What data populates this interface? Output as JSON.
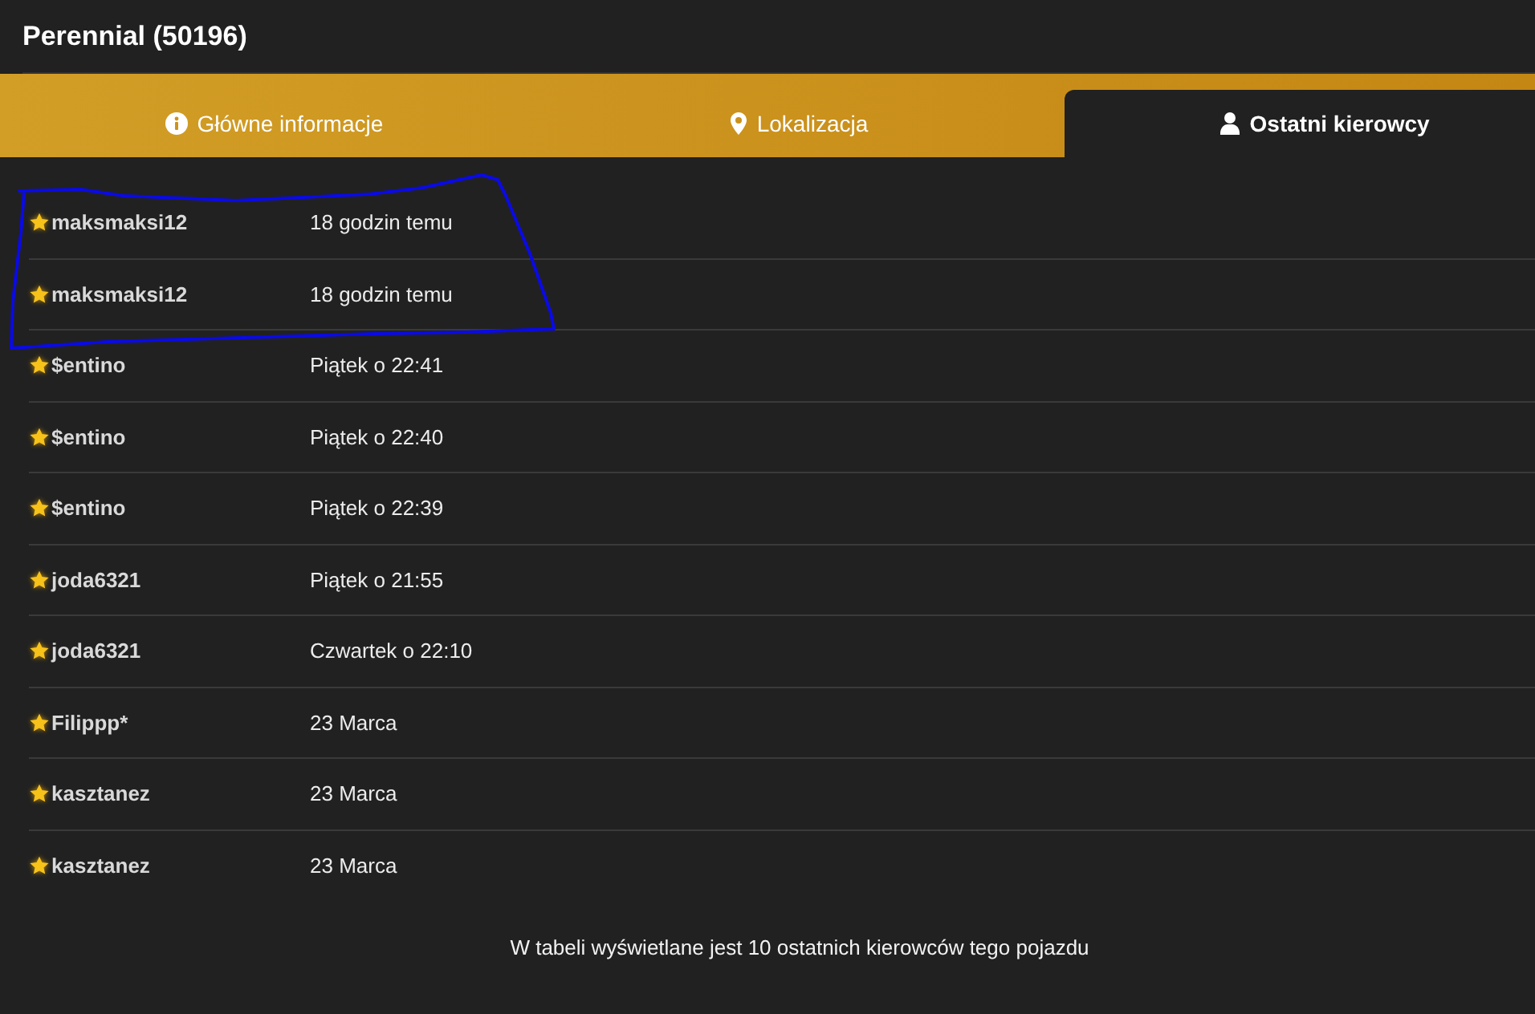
{
  "header": {
    "title": "Perennial (50196)"
  },
  "tabs": [
    {
      "label": "Główne informacje",
      "selected": false
    },
    {
      "label": "Lokalizacja",
      "selected": false
    },
    {
      "label": "Ostatni kierowcy",
      "selected": true
    }
  ],
  "drivers": [
    {
      "name": "maksmaksi12",
      "time": "18 godzin temu"
    },
    {
      "name": "maksmaksi12",
      "time": "18 godzin temu"
    },
    {
      "name": "$entino",
      "time": "Piątek o 22:41"
    },
    {
      "name": "$entino",
      "time": "Piątek o 22:40"
    },
    {
      "name": "$entino",
      "time": "Piątek o 22:39"
    },
    {
      "name": "joda6321",
      "time": "Piątek o 21:55"
    },
    {
      "name": "joda6321",
      "time": "Czwartek o 22:10"
    },
    {
      "name": "Filippp*",
      "time": "23 Marca"
    },
    {
      "name": "kasztanez",
      "time": "23 Marca"
    },
    {
      "name": "kasztanez",
      "time": "23 Marca"
    }
  ],
  "footer_note": "W tabeli wyświetlane jest 10 ostatnich kierowców tego pojazdu"
}
